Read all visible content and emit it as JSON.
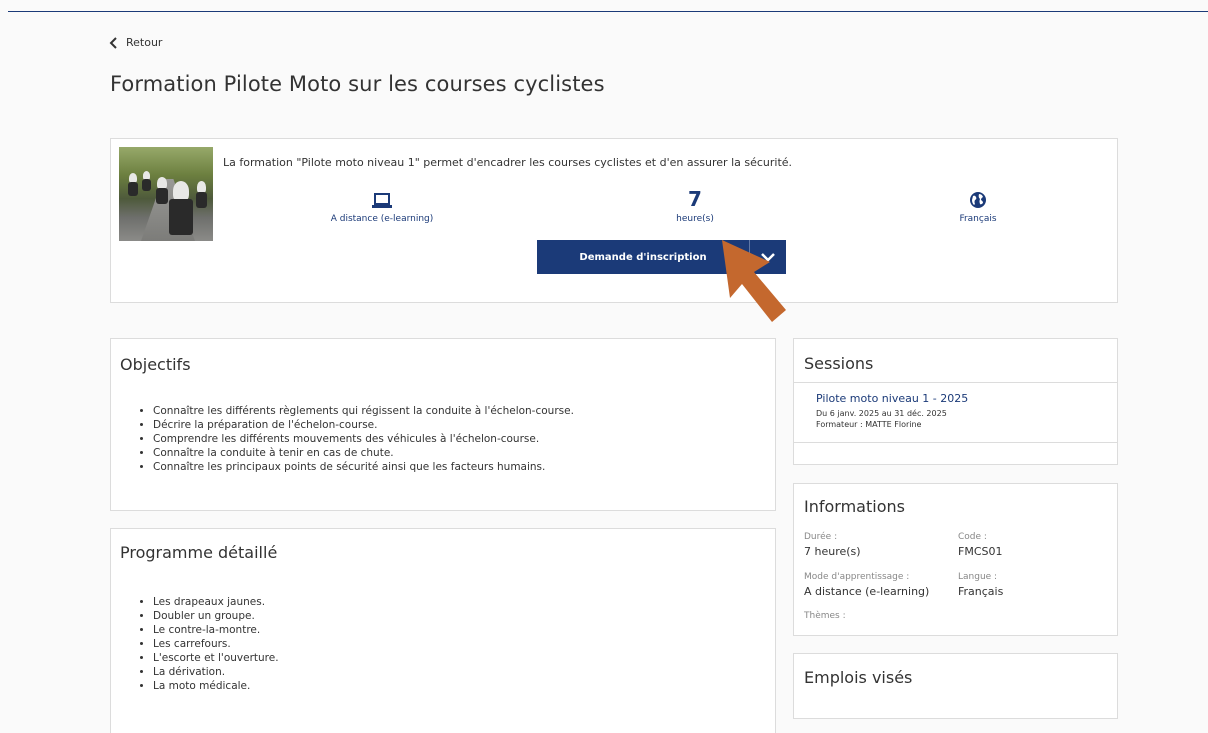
{
  "nav": {
    "back_label": "Retour"
  },
  "page": {
    "title": "Formation Pilote Moto sur les courses cyclistes"
  },
  "hero": {
    "description": "La formation \"Pilote moto niveau 1\" permet d'encadrer les courses cyclistes et d'en assurer la sécurité.",
    "features": {
      "mode": {
        "icon": "laptop-icon",
        "label": "A distance (e-learning)"
      },
      "duration": {
        "value": "7",
        "label": "heure(s)"
      },
      "language": {
        "icon": "globe-icon",
        "label": "Français"
      }
    },
    "cta": {
      "label": "Demande d'inscription",
      "dropdown_icon": "chevron-down-icon"
    }
  },
  "objectifs": {
    "title": "Objectifs",
    "items": [
      "Connaître les différents règlements qui régissent la conduite à l'échelon-course.",
      "Décrire la préparation de l'échelon-course.",
      "Comprendre les différents mouvements des véhicules à l'échelon-course.",
      "Connaître la conduite à tenir en cas de chute.",
      "Connaître les principaux points de sécurité ainsi que les facteurs humains."
    ]
  },
  "programme": {
    "title": "Programme détaillé",
    "items": [
      "Les drapeaux jaunes.",
      "Doubler un groupe.",
      "Le contre-la-montre.",
      "Les carrefours.",
      "L'escorte et l'ouverture.",
      "La dérivation.",
      "La moto médicale."
    ]
  },
  "sessions": {
    "title": "Sessions",
    "items": [
      {
        "name": "Pilote moto niveau 1 - 2025",
        "dates": "Du 6 janv. 2025 au 31 déc. 2025",
        "trainer": "Formateur : MATTE Florine"
      }
    ]
  },
  "informations": {
    "title": "Informations",
    "duree_label": "Durée :",
    "duree_value": "7 heure(s)",
    "code_label": "Code :",
    "code_value": "FMCS01",
    "mode_label": "Mode d'apprentissage :",
    "mode_value": "A distance (e-learning)",
    "langue_label": "Langue :",
    "langue_value": "Français",
    "themes_label": "Thèmes :"
  },
  "emplois": {
    "title": "Emplois visés"
  },
  "colors": {
    "primary": "#1b3a78",
    "accent_arrow": "#c4682e",
    "border": "#dcdcdc"
  }
}
